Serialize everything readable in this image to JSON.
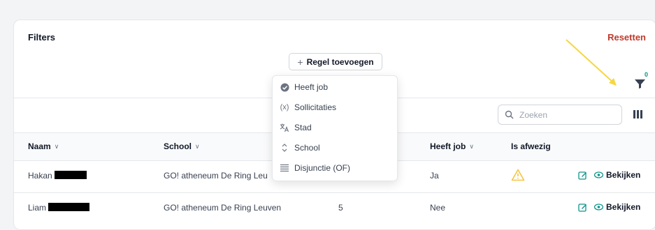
{
  "filters": {
    "title": "Filters",
    "reset_label": "Resetten",
    "add_rule_label": "Regel toevoegen",
    "active_count": "0"
  },
  "rule_menu": {
    "items": [
      {
        "label": "Heeft job",
        "icon": "check-circle-icon"
      },
      {
        "label": "Sollicitaties",
        "icon": "variable-icon"
      },
      {
        "label": "Stad",
        "icon": "translate-icon"
      },
      {
        "label": "School",
        "icon": "updown-icon"
      },
      {
        "label": "Disjunctie (OF)",
        "icon": "lines-icon"
      }
    ]
  },
  "search": {
    "placeholder": "Zoeken",
    "value": ""
  },
  "table": {
    "headers": {
      "naam": "Naam",
      "school": "School",
      "heeft_job": "Heeft job",
      "is_afwezig": "Is afwezig"
    },
    "rows": [
      {
        "name": "Hakan",
        "school": "GO! atheneum De Ring Leu",
        "count": "",
        "heeft_job": "Ja",
        "absent_warning": true,
        "view_label": "Bekijken"
      },
      {
        "name": "Liam",
        "school": "GO! atheneum De Ring Leuven",
        "count": "5",
        "heeft_job": "Nee",
        "absent_warning": false,
        "view_label": "Bekijken"
      }
    ]
  },
  "colors": {
    "accent": "#0d9488",
    "reset": "#c0392b",
    "warning": "#f5c542",
    "annotation_arrow": "#f5d742"
  }
}
